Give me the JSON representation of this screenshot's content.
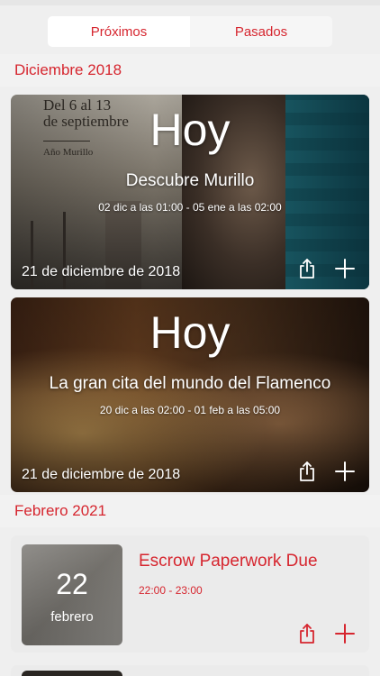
{
  "tabs": {
    "upcoming_label": "Próximos",
    "past_label": "Pasados"
  },
  "sections": [
    {
      "header": "Diciembre 2018",
      "events": [
        {
          "badge": "Hoy",
          "title": "Descubre Murillo",
          "range": "02 dic a las 01:00 - 05 ene a las 02:00",
          "date": "21 de diciembre de 2018",
          "poster_text": {
            "line1": "Del 6 al 13",
            "line2": "de septiembre",
            "line3": "Año Murillo"
          }
        },
        {
          "badge": "Hoy",
          "title": "La gran cita del mundo del Flamenco",
          "range": "20 dic a las 02:00 - 01 feb a las 05:00",
          "date": "21 de diciembre de 2018"
        }
      ]
    },
    {
      "header": "Febrero 2021",
      "events": [
        {
          "day": "22",
          "month": "febrero",
          "title": "Escrow Paperwork Due",
          "time": "22:00 - 23:00"
        }
      ]
    }
  ],
  "icons": {
    "share": "share-icon",
    "add": "plus-icon"
  },
  "colors": {
    "accent": "#d6262f",
    "background": "#efefef"
  }
}
